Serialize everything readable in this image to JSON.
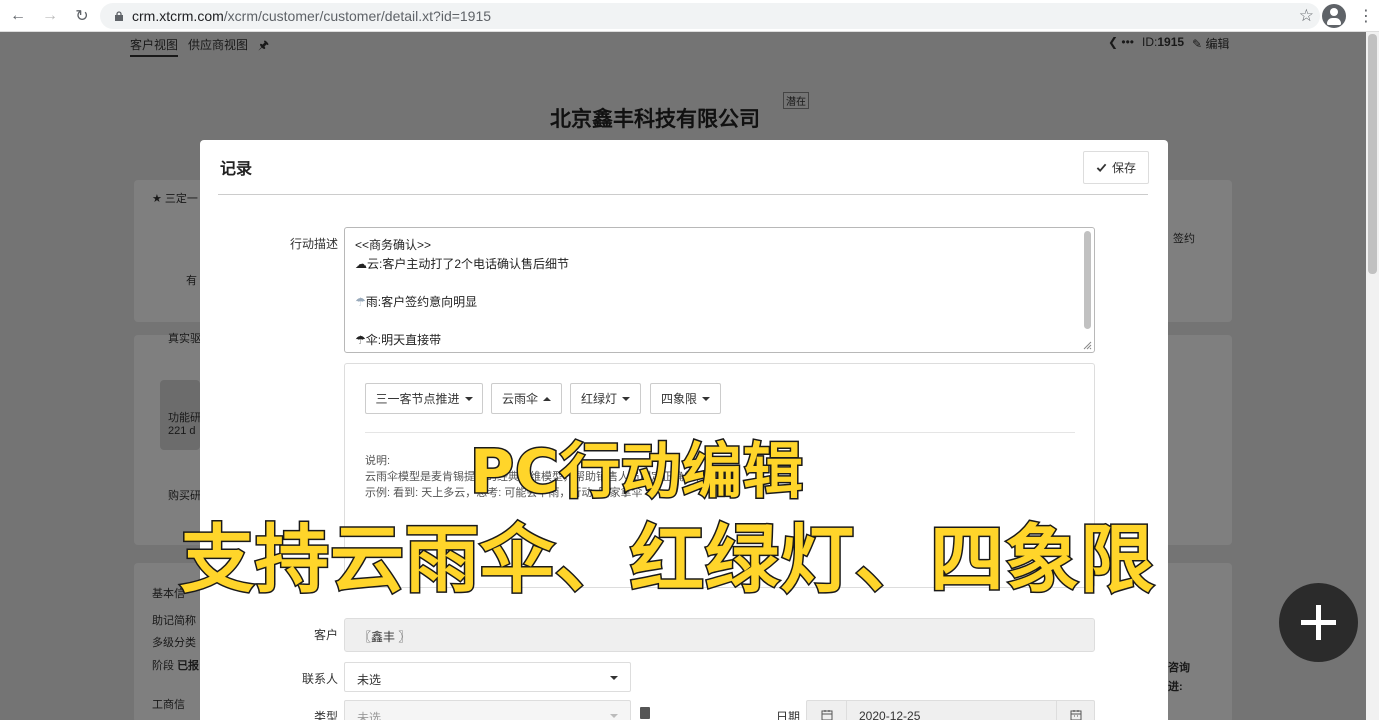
{
  "browser": {
    "url_host": "crm.xtcrm.com",
    "url_path": "/xcrm/customer/customer/detail.xt?id=1915"
  },
  "page": {
    "tabs": [
      "客户视图",
      "供应商视图"
    ],
    "id_label": "ID:",
    "id_value": "1915",
    "edit_label": "编辑",
    "nav_dots": "❮ •••",
    "company_name": "北京鑫丰科技有限公司",
    "status_tag": "潜在",
    "bg_texts": {
      "three": "★ 三定一",
      "you": "有",
      "real": "真实驱",
      "func": "功能研",
      "days": "221 d",
      "buy": "购买研",
      "sign": "签约",
      "basic": "基本信",
      "alias": "助记简称",
      "multi": "多级分类",
      "stage": "阶段",
      "stage_val": "已报",
      "biz": "工商信",
      "consult": "咨询",
      "progress": "进:"
    }
  },
  "modal": {
    "title": "记录",
    "save_label": "保存",
    "desc_label": "行动描述",
    "desc_lines": [
      "<<商务确认>>",
      "云:客户主动打了2个电话确认售后细节",
      "",
      "雨:客户签约意向明显",
      "",
      "伞:明天直接带"
    ],
    "dropdowns": [
      "三一客节点推进",
      "云雨伞",
      "红绿灯",
      "四象限"
    ],
    "explain_lines": [
      "说明:",
      "云雨伞模型是麦肯锡提出的经典思维模型，帮助销售人员制定正确的行动方案",
      "示例: 看到: 天上多云，思考: 可能会下雨，行动: 回家拿伞"
    ],
    "customer_label": "客户",
    "customer_value": "〖鑫丰 〗",
    "contact_label": "联系人",
    "contact_value": "未选",
    "type_label": "类型",
    "type_value": "未选",
    "date_label": "日期",
    "date_value": "2020-12-25"
  },
  "caption": {
    "line1": "PC行动编辑",
    "line2": "支持云雨伞、红绿灯、四象限"
  }
}
